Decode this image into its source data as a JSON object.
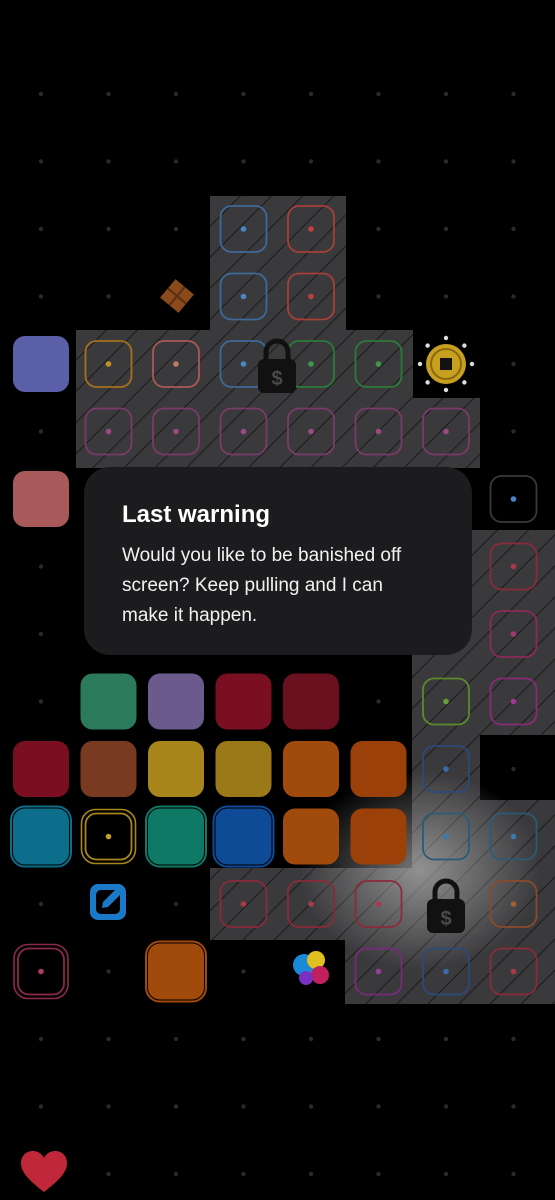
{
  "dialog": {
    "title": "Last warning",
    "message": "Would you like to be banished off screen? Keep pulling and I can make it happen."
  },
  "icons": {
    "lock": "dollar-lock-icon",
    "coin": "coin-icon",
    "edit": "edit-icon",
    "heart": "heart-icon",
    "chocolate": "chocolate-piece-icon",
    "orbs": "color-orbs-icon"
  },
  "colors": {
    "background": "#000000",
    "panel": "#1c1c1e",
    "blue": "#5b5fa8",
    "salmon": "#a85a5a",
    "green": "#2c7a5c",
    "purple": "#6b5b8c",
    "crimson": "#7a0f22",
    "rust": "#7a3a22",
    "gold": "#a8861c",
    "orange": "#a04a0c",
    "teal": "#0c6e8a",
    "sea": "#0e7a66",
    "navy": "#0e4a96",
    "heart": "#c0283a"
  }
}
